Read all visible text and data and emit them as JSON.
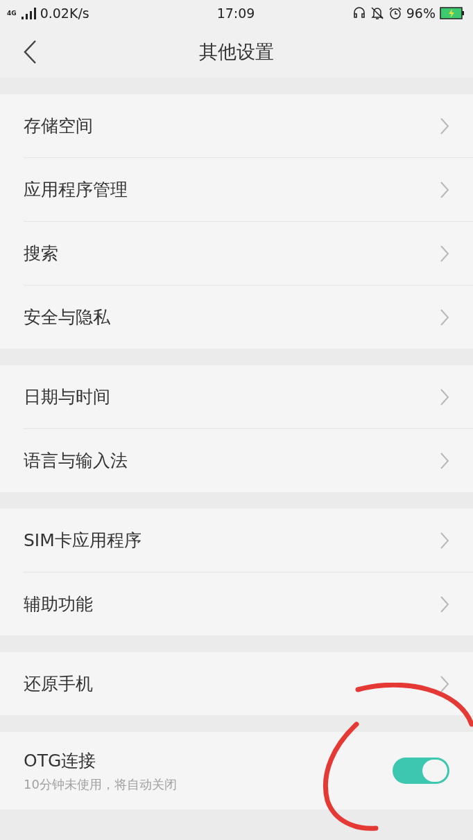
{
  "status_bar": {
    "network": "4G",
    "speed": "0.02K/s",
    "time": "17:09",
    "battery": "96%",
    "charging": true
  },
  "header": {
    "title": "其他设置"
  },
  "groups": [
    {
      "items": [
        {
          "kind": "link",
          "label": "存储空间"
        },
        {
          "kind": "link",
          "label": "应用程序管理"
        },
        {
          "kind": "link",
          "label": "搜索"
        },
        {
          "kind": "link",
          "label": "安全与隐私"
        }
      ]
    },
    {
      "items": [
        {
          "kind": "link",
          "label": "日期与时间"
        },
        {
          "kind": "link",
          "label": "语言与输入法"
        }
      ]
    },
    {
      "items": [
        {
          "kind": "link",
          "label": "SIM卡应用程序"
        },
        {
          "kind": "link",
          "label": "辅助功能"
        }
      ]
    },
    {
      "items": [
        {
          "kind": "link",
          "label": "还原手机"
        }
      ]
    },
    {
      "items": [
        {
          "kind": "switch",
          "label": "OTG连接",
          "subtitle": "10分钟未使用，将自动关闭",
          "on": true
        }
      ]
    }
  ]
}
